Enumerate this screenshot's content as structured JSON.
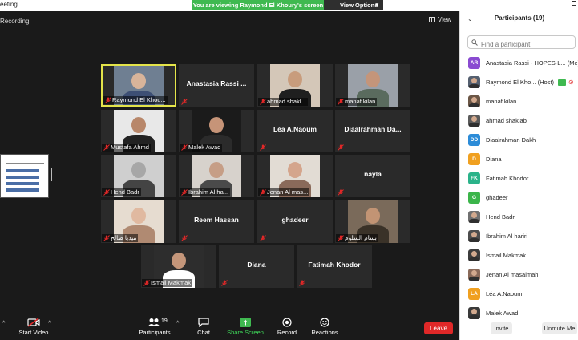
{
  "window": {
    "title": "eeting",
    "share_banner": "You are viewing Raymond El Khoury's screen",
    "view_options": "View Options"
  },
  "stage": {
    "recording": "Recording",
    "view_label": "View"
  },
  "tiles": [
    {
      "label": "Raymond El Khou...",
      "center": "",
      "active": true,
      "kind": "photo"
    },
    {
      "label": "",
      "center": "Anastasia Rassi ...",
      "active": false,
      "kind": "name"
    },
    {
      "label": "ahmad shakl...",
      "center": "",
      "active": false,
      "kind": "photo"
    },
    {
      "label": "manaf kilan",
      "center": "",
      "active": false,
      "kind": "photo"
    },
    {
      "label": "Mustafa Ahmd",
      "center": "",
      "active": false,
      "kind": "photo"
    },
    {
      "label": "Malek Awad",
      "center": "",
      "active": false,
      "kind": "photo"
    },
    {
      "label": "",
      "center": "Léa A.Naoum",
      "active": false,
      "kind": "name"
    },
    {
      "label": "",
      "center": "Diaalrahman  Da...",
      "active": false,
      "kind": "name"
    },
    {
      "label": "Hend Badr",
      "center": "",
      "active": false,
      "kind": "photo"
    },
    {
      "label": "Ibrahim Al ha...",
      "center": "",
      "active": false,
      "kind": "photo"
    },
    {
      "label": "Jenan Al mas...",
      "center": "",
      "active": false,
      "kind": "photo"
    },
    {
      "label": "",
      "center": "nayla",
      "active": false,
      "kind": "name"
    },
    {
      "label": "ميديا صالح",
      "center": "",
      "active": false,
      "kind": "photo"
    },
    {
      "label": "",
      "center": "Reem Hassan",
      "active": false,
      "kind": "name"
    },
    {
      "label": "",
      "center": "ghadeer",
      "active": false,
      "kind": "name"
    },
    {
      "label": "بسام السلوم",
      "center": "",
      "active": false,
      "kind": "photo"
    },
    {
      "label": "Ismail Makmak",
      "center": "",
      "active": false,
      "kind": "photo"
    },
    {
      "label": "",
      "center": "Diana",
      "active": false,
      "kind": "name"
    },
    {
      "label": "",
      "center": "Fatimah Khodor",
      "active": false,
      "kind": "name"
    }
  ],
  "toolbar": {
    "start_video": "Start Video",
    "participants": "Participants",
    "participants_count": "19",
    "chat": "Chat",
    "share_screen": "Share Screen",
    "record": "Record",
    "reactions": "Reactions",
    "leave": "Leave"
  },
  "panel": {
    "title": "Participants (19)",
    "search_placeholder": "Find a participant",
    "participants": [
      {
        "name": "Anastasia Rassi - HOPES-L...",
        "suffix": "(Me)",
        "initials": "AR",
        "color": "#8a4bd1",
        "photo": false
      },
      {
        "name": "Raymond El Kho...",
        "suffix": "(Host)",
        "initials": "",
        "color": "#556070",
        "photo": true
      },
      {
        "name": "manaf kilan",
        "suffix": "",
        "initials": "",
        "color": "#6b5646",
        "photo": true
      },
      {
        "name": "ahmad shaklab",
        "suffix": "",
        "initials": "",
        "color": "#5b5b5b",
        "photo": true
      },
      {
        "name": "Diaalrahman Dakh",
        "suffix": "",
        "initials": "DD",
        "color": "#2d8cd8",
        "photo": false
      },
      {
        "name": "Diana",
        "suffix": "",
        "initials": "D",
        "color": "#f0a020",
        "photo": false
      },
      {
        "name": "Fatimah Khodor",
        "suffix": "",
        "initials": "FK",
        "color": "#2bb38a",
        "photo": false
      },
      {
        "name": "ghadeer",
        "suffix": "",
        "initials": "G",
        "color": "#3bb54a",
        "photo": false
      },
      {
        "name": "Hend Badr",
        "suffix": "",
        "initials": "",
        "color": "#707070",
        "photo": true
      },
      {
        "name": "Ibrahim Al hariri",
        "suffix": "",
        "initials": "",
        "color": "#4d4d4d",
        "photo": true
      },
      {
        "name": "Ismail Makmak",
        "suffix": "",
        "initials": "",
        "color": "#3c3c3c",
        "photo": true
      },
      {
        "name": "Jenan Al masalmah",
        "suffix": "",
        "initials": "",
        "color": "#8a6a5a",
        "photo": true
      },
      {
        "name": "Léa A.Naoum",
        "suffix": "",
        "initials": "LA",
        "color": "#f0a020",
        "photo": false
      },
      {
        "name": "Malek Awad",
        "suffix": "",
        "initials": "",
        "color": "#3a3a3a",
        "photo": true
      }
    ],
    "invite": "Invite",
    "unmute_me": "Unmute Me"
  }
}
